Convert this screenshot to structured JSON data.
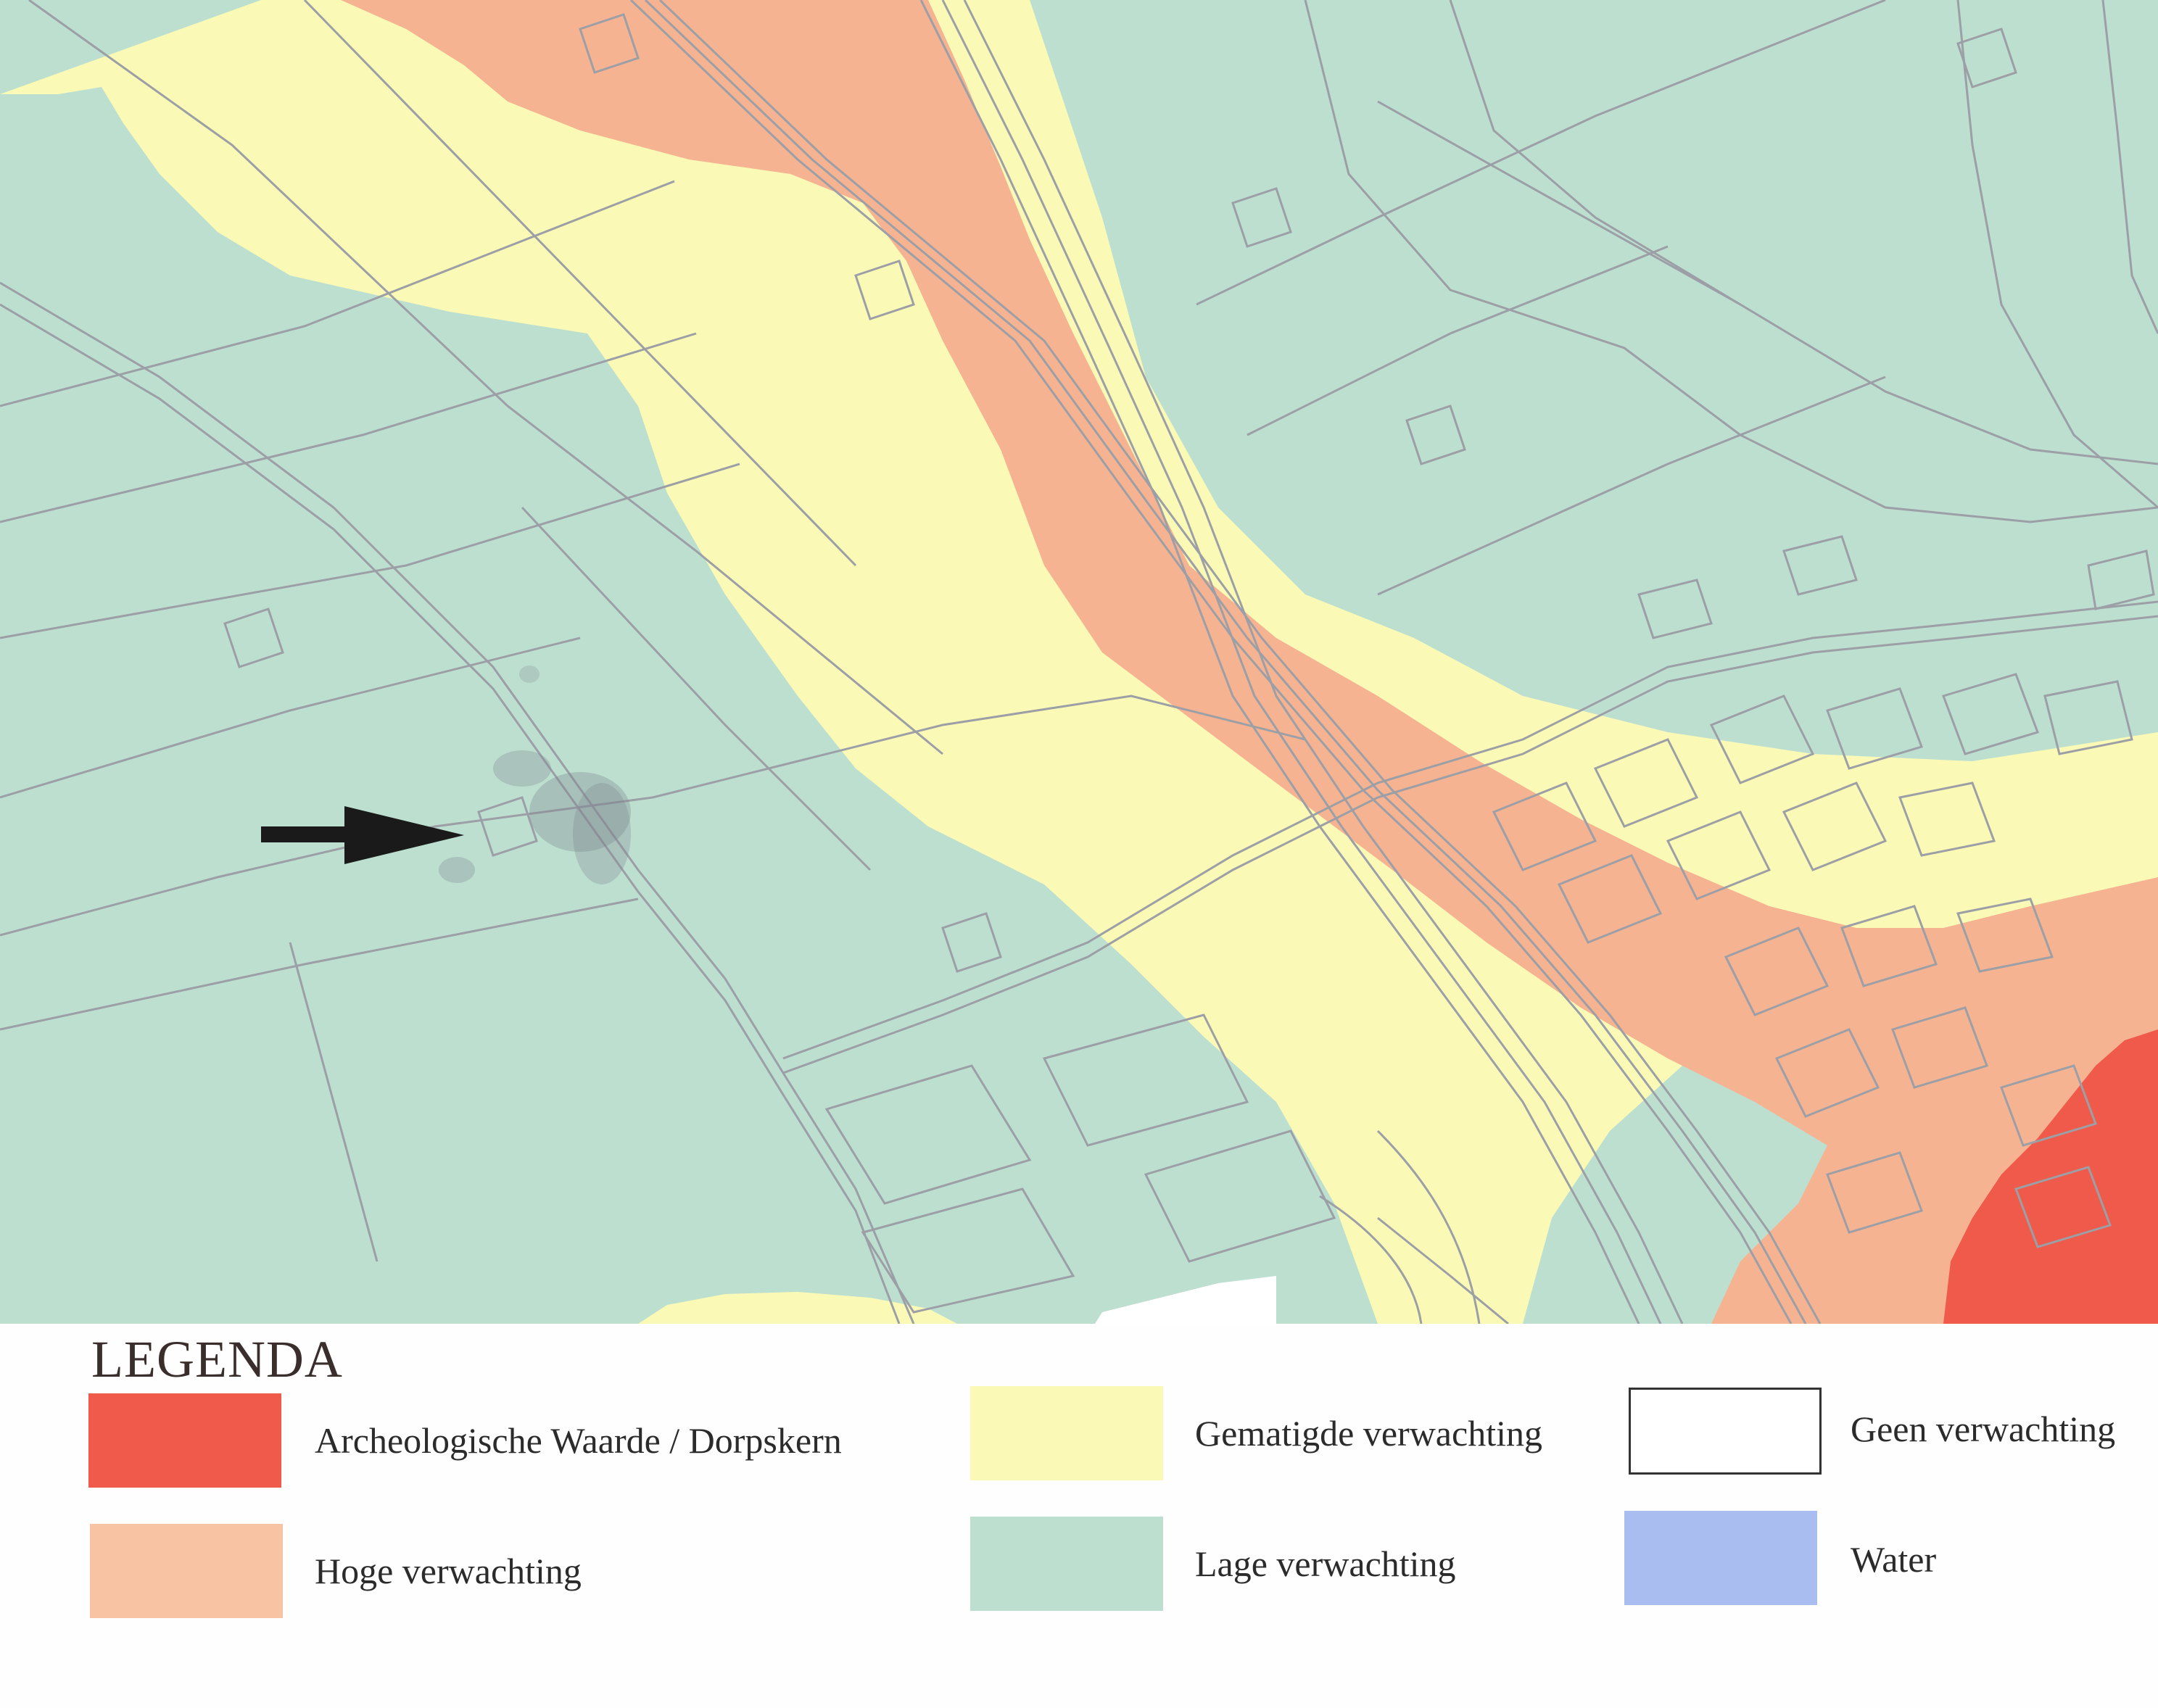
{
  "map": {
    "name": "archaeological-expectation-map",
    "zone_colors": {
      "lage": "#bddfd0",
      "gematigde": "#fafab6",
      "hoge": "#f6b392",
      "archeologische": "#ef5a4a",
      "geen": "#ffffff",
      "water": "#a9bdf1"
    },
    "line_color": "#9c9fa6",
    "arrow_color": "#1a1a1a",
    "smudge_color": "#7f8690"
  },
  "legend": {
    "title": "LEGENDA",
    "items": [
      {
        "id": "archeologische-waarde",
        "label": "Archeologische Waarde / Dorpskern",
        "color": "#ef5a4a",
        "border": "none"
      },
      {
        "id": "hoge-verwachting",
        "label": "Hoge verwachting",
        "color": "#f8c3a3",
        "border": "none"
      },
      {
        "id": "gematigde-verwachting",
        "label": "Gematigde verwachting",
        "color": "#fafab6",
        "border": "none"
      },
      {
        "id": "lage-verwachting",
        "label": "Lage verwachting",
        "color": "#bddfd0",
        "border": "none"
      },
      {
        "id": "geen-verwachting",
        "label": "Geen verwachting",
        "color": "#ffffff",
        "border": "#333333"
      },
      {
        "id": "water",
        "label": "Water",
        "color": "#a9bdf1",
        "border": "none"
      }
    ]
  }
}
